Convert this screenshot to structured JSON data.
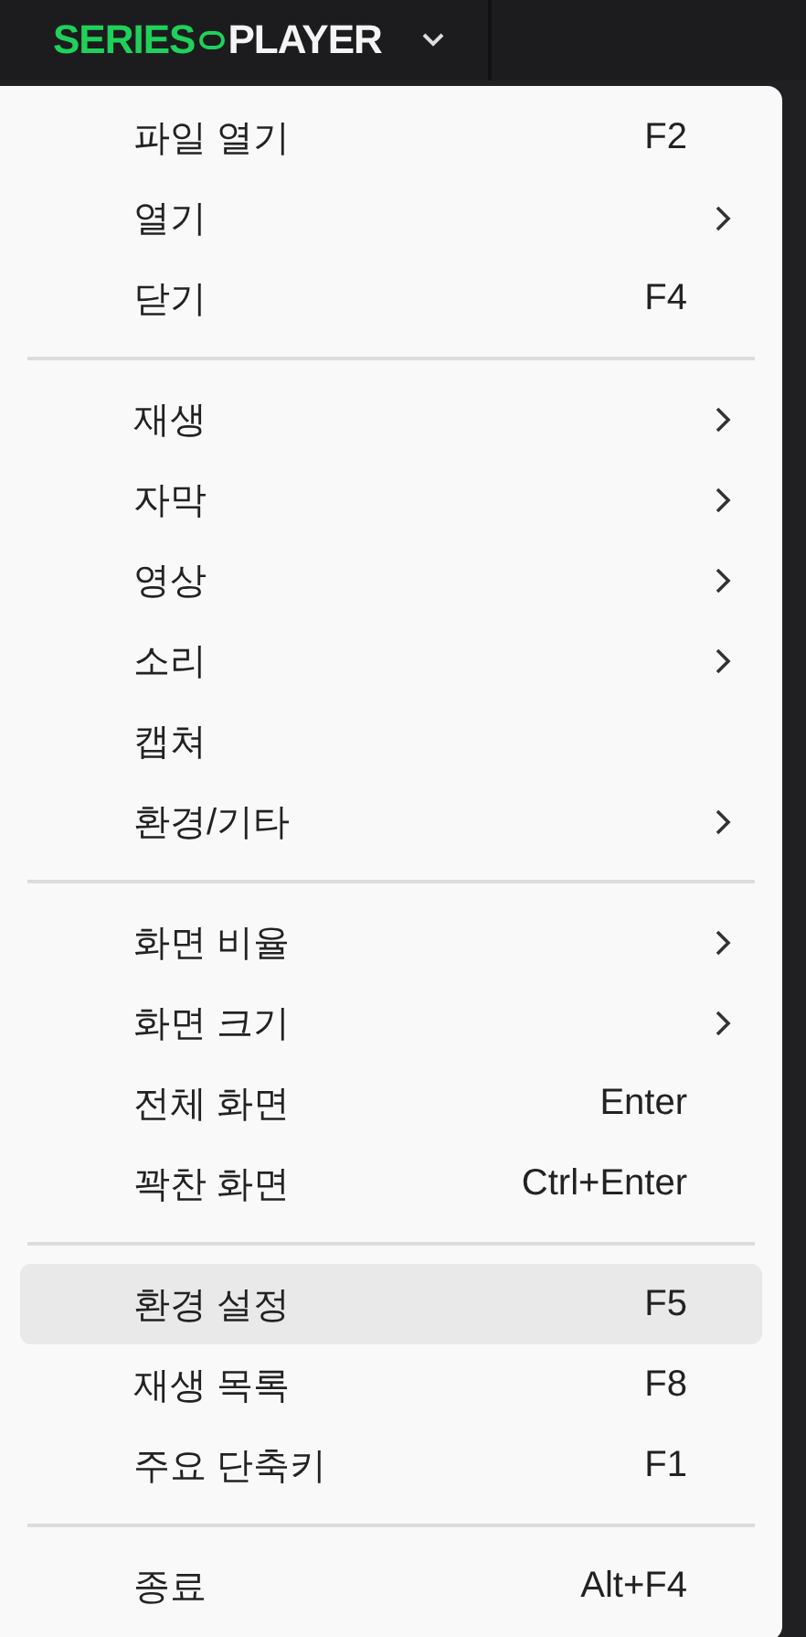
{
  "header": {
    "logo": {
      "left": "SERIES",
      "right": "PLAYER"
    }
  },
  "menu": {
    "groups": [
      [
        {
          "label": "파일 열기",
          "kind": "shortcut",
          "shortcut": "F2",
          "selected": false
        },
        {
          "label": "열기",
          "kind": "submenu",
          "selected": false
        },
        {
          "label": "닫기",
          "kind": "shortcut",
          "shortcut": "F4",
          "selected": false
        }
      ],
      [
        {
          "label": "재생",
          "kind": "submenu",
          "selected": false
        },
        {
          "label": "자막",
          "kind": "submenu",
          "selected": false
        },
        {
          "label": "영상",
          "kind": "submenu",
          "selected": false
        },
        {
          "label": "소리",
          "kind": "submenu",
          "selected": false
        },
        {
          "label": "캡쳐",
          "kind": "plain",
          "selected": false
        },
        {
          "label": "환경/기타",
          "kind": "submenu",
          "selected": false
        }
      ],
      [
        {
          "label": "화면 비율",
          "kind": "submenu",
          "selected": false
        },
        {
          "label": "화면 크기",
          "kind": "submenu",
          "selected": false
        },
        {
          "label": "전체 화면",
          "kind": "shortcut",
          "shortcut": "Enter",
          "selected": false
        },
        {
          "label": "꽉찬 화면",
          "kind": "shortcut",
          "shortcut": "Ctrl+Enter",
          "selected": false
        }
      ],
      [
        {
          "label": "환경 설정",
          "kind": "shortcut",
          "shortcut": "F5",
          "selected": true
        },
        {
          "label": "재생 목록",
          "kind": "shortcut",
          "shortcut": "F8",
          "selected": false
        },
        {
          "label": "주요 단축키",
          "kind": "shortcut",
          "shortcut": "F1",
          "selected": false
        }
      ],
      [
        {
          "label": "종료",
          "kind": "shortcut",
          "shortcut": "Alt+F4",
          "selected": false
        }
      ]
    ]
  }
}
